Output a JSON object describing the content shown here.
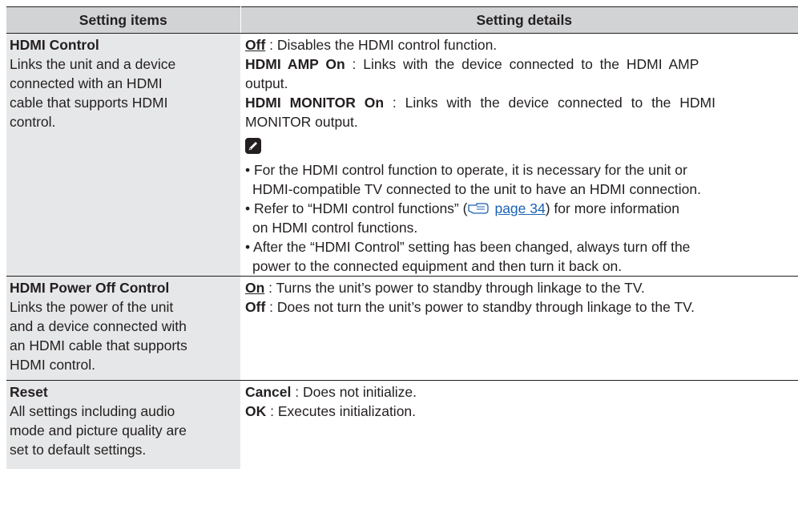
{
  "header": {
    "col1": "Setting items",
    "col2": "Setting details"
  },
  "rows": [
    {
      "title": "HDMI Control",
      "desc_lines": [
        "Links the unit and a device",
        "connected with an HDMI",
        "cable that supports HDMI",
        "control."
      ],
      "options": [
        {
          "key": "Off",
          "sep": " : ",
          "text": "Disables the HDMI control function."
        },
        {
          "key": "HDMI AMP On",
          "sep": " : ",
          "text": "Links with the device connected to the HDMI AMP",
          "cont": "output."
        },
        {
          "key": "HDMI MONITOR On",
          "sep": " : ",
          "text": "Links with the device connected to the HDMI",
          "cont": "MONITOR output."
        }
      ],
      "notes": [
        {
          "l1": "• For the HDMI control function to operate, it is necessary for the unit or",
          "l2": "HDMI-compatible TV connected to the unit to have an HDMI connection."
        },
        {
          "l1_a": "• Refer to “HDMI control functions” (",
          "l1_link": "page 34",
          "l1_b": ") for more information",
          "l2": "on HDMI control functions."
        },
        {
          "l1": "• After the “HDMI Control” setting has been changed, always turn off the",
          "l2": "power to the connected equipment and then turn it back on."
        }
      ]
    },
    {
      "title": "HDMI Power Off Control",
      "desc_lines": [
        "Links the power of the unit",
        "and a device connected with",
        "an HDMI cable that supports",
        "HDMI control."
      ],
      "options": [
        {
          "key": "On",
          "sep": " : ",
          "text": "Turns the unit’s power to standby through linkage to the TV."
        },
        {
          "key": "Off",
          "sep": " : ",
          "text": "Does not turn the unit’s power to standby through linkage to the TV."
        }
      ]
    },
    {
      "title": "Reset",
      "desc_lines": [
        "All settings including audio",
        "mode and picture quality are",
        "set to default settings."
      ],
      "options": [
        {
          "key": "Cancel",
          "sep": " : ",
          "text": "Does not initialize."
        },
        {
          "key": "OK",
          "sep": " : ",
          "text": "Executes initialization."
        }
      ]
    }
  ],
  "colors": {
    "header_bg": "#d2d3d5",
    "left_bg": "#e6e7e8",
    "link": "#1a62b4",
    "text": "#231f20"
  },
  "icons": {
    "note": "pencil-icon",
    "reference": "pointing-hand-icon"
  }
}
